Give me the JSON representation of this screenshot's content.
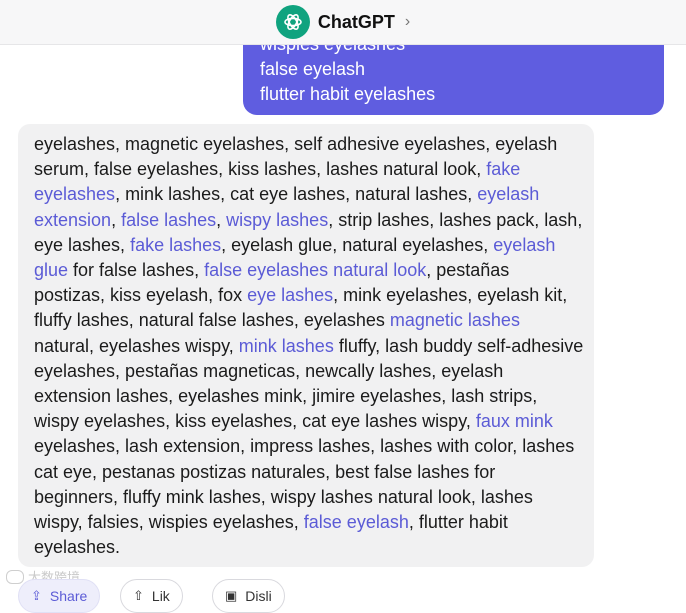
{
  "header": {
    "title": "ChatGPT",
    "chevron": "›"
  },
  "user_message": {
    "lines": [
      "wispies eyelashes",
      "false eyelash",
      "flutter habit eyelashes"
    ]
  },
  "assistant_message": {
    "segments": [
      {
        "t": "eyelashes, magnetic eyelashes, self adhesive eyelashes, eyelash serum, false eyelashes, kiss lashes, lashes natural look, ",
        "link": false
      },
      {
        "t": "fake eyelashes",
        "link": true
      },
      {
        "t": ", mink lashes, cat eye lashes, natural lashes, ",
        "link": false
      },
      {
        "t": "eyelash extension",
        "link": true
      },
      {
        "t": ", ",
        "link": false
      },
      {
        "t": "false lashes",
        "link": true
      },
      {
        "t": ", ",
        "link": false
      },
      {
        "t": "wispy lashes",
        "link": true
      },
      {
        "t": ", strip lashes, lashes pack, lash, eye lashes, ",
        "link": false
      },
      {
        "t": "fake lashes",
        "link": true
      },
      {
        "t": ", eyelash glue, natural eyelashes, ",
        "link": false
      },
      {
        "t": "eyelash glue",
        "link": true
      },
      {
        "t": " for false lashes, ",
        "link": false
      },
      {
        "t": "false eyelashes natural look",
        "link": true
      },
      {
        "t": ", pestañas postizas, kiss eyelash, fox ",
        "link": false
      },
      {
        "t": "eye lashes",
        "link": true
      },
      {
        "t": ", mink eyelashes, eyelash kit, fluffy lashes, natural false lashes, eyelashes ",
        "link": false
      },
      {
        "t": "magnetic lashes",
        "link": true
      },
      {
        "t": " natural, eyelashes wispy, ",
        "link": false
      },
      {
        "t": "mink lashes",
        "link": true
      },
      {
        "t": " fluffy, lash buddy self-adhesive eyelashes, pestañas magneticas, newcally lashes, eyelash extension lashes, eyelashes mink, jimire eyelashes, lash strips, wispy eyelashes, kiss eyelashes, cat eye lashes wispy, ",
        "link": false
      },
      {
        "t": "faux mink",
        "link": true
      },
      {
        "t": " eyelashes, lash extension, impress lashes, lashes with color, lashes cat eye, pestanas postizas naturales, best false lashes for beginners, fluffy mink lashes, wispy lashes natural look, lashes wispy, falsies, wispies eyelashes, ",
        "link": false
      },
      {
        "t": "false eyelash",
        "link": true
      },
      {
        "t": ", flutter habit eyelashes.",
        "link": false
      }
    ]
  },
  "watermark": {
    "text": "大数跨境"
  },
  "actions": [
    {
      "label": "Share",
      "icon": "share-icon",
      "glyph": "⇪"
    },
    {
      "label": "Lik",
      "icon": "thumb-up-icon",
      "glyph": "⇧"
    },
    {
      "label": "Disli",
      "icon": "thumb-down-icon",
      "glyph": "▣"
    }
  ],
  "colors": {
    "user_bubble": "#5f5de0",
    "keyword": "#5b5bd6",
    "assistant_bg": "#f1f1f2",
    "brand": "#10a37f"
  }
}
